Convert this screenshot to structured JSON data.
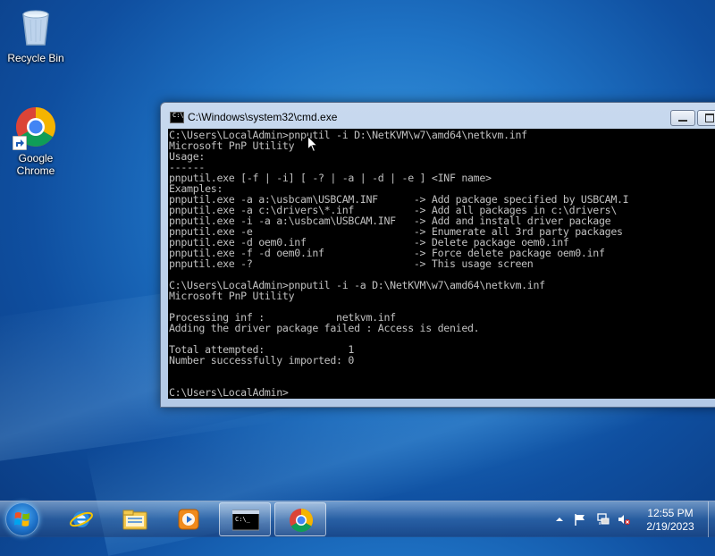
{
  "desktop": {
    "icons": [
      {
        "label": "Recycle Bin",
        "icon": "recycle-bin-icon"
      },
      {
        "label": "Google Chrome",
        "icon": "chrome-icon"
      }
    ]
  },
  "cmd_window": {
    "title": "C:\\Windows\\system32\\cmd.exe",
    "icon": "cmd-icon",
    "console_lines": [
      "C:\\Users\\LocalAdmin>pnputil -i D:\\NetKVM\\w7\\amd64\\netkvm.inf",
      "Microsoft PnP Utility",
      "Usage:",
      "------",
      "pnputil.exe [-f | -i] [ -? | -a | -d | -e ] <INF name>",
      "Examples:",
      "pnputil.exe -a a:\\usbcam\\USBCAM.INF      -> Add package specified by USBCAM.I",
      "pnputil.exe -a c:\\drivers\\*.inf          -> Add all packages in c:\\drivers\\",
      "pnputil.exe -i -a a:\\usbcam\\USBCAM.INF   -> Add and install driver package",
      "pnputil.exe -e                           -> Enumerate all 3rd party packages",
      "pnputil.exe -d oem0.inf                  -> Delete package oem0.inf",
      "pnputil.exe -f -d oem0.inf               -> Force delete package oem0.inf",
      "pnputil.exe -?                           -> This usage screen",
      "",
      "C:\\Users\\LocalAdmin>pnputil -i -a D:\\NetKVM\\w7\\amd64\\netkvm.inf",
      "Microsoft PnP Utility",
      "",
      "Processing inf :            netkvm.inf",
      "Adding the driver package failed : Access is denied.",
      "",
      "Total attempted:              1",
      "Number successfully imported: 0",
      "",
      "",
      "C:\\Users\\LocalAdmin>"
    ]
  },
  "taskbar": {
    "start": "windows-start-icon",
    "pinned": [
      {
        "name": "internet-explorer-icon",
        "active": false
      },
      {
        "name": "windows-explorer-icon",
        "active": false
      },
      {
        "name": "media-player-icon",
        "active": false
      },
      {
        "name": "cmd-icon",
        "active": true
      },
      {
        "name": "chrome-icon",
        "active": true
      }
    ],
    "tray_icons": [
      "show-hidden-icons-icon",
      "action-center-flag-icon",
      "network-icon",
      "volume-muted-icon"
    ],
    "clock": {
      "time": "12:55 PM",
      "date": "2/19/2023"
    }
  },
  "colors": {
    "desktop_blue": "#1f74c6",
    "console_bg": "#000000",
    "console_text": "#c0c0c0"
  }
}
